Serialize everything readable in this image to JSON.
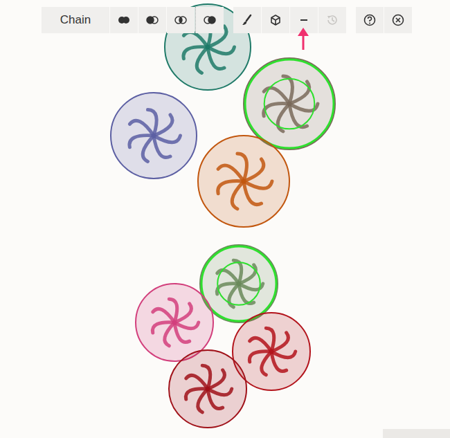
{
  "toolbar": {
    "mode_label": "Chain",
    "buttons": [
      {
        "disabled": false
      },
      {
        "disabled": false
      },
      {
        "disabled": false
      },
      {
        "disabled": false
      },
      {
        "disabled": false
      },
      {
        "disabled": false
      },
      {
        "disabled": false
      },
      {
        "disabled": true
      },
      {
        "disabled": false
      },
      {
        "disabled": false
      }
    ]
  },
  "chains": [
    {
      "color": "#1f7a68",
      "selected": false
    },
    {
      "color": "#5c5fa3",
      "selected": false
    },
    {
      "color": "#7a6a5a",
      "selected": true
    },
    {
      "color": "#c2570f",
      "selected": false
    },
    {
      "color": "#6a8a5a",
      "selected": true
    },
    {
      "color": "#d23f7c",
      "selected": false
    },
    {
      "color": "#b3141c",
      "selected": false
    },
    {
      "color": "#a0121a",
      "selected": false
    }
  ]
}
